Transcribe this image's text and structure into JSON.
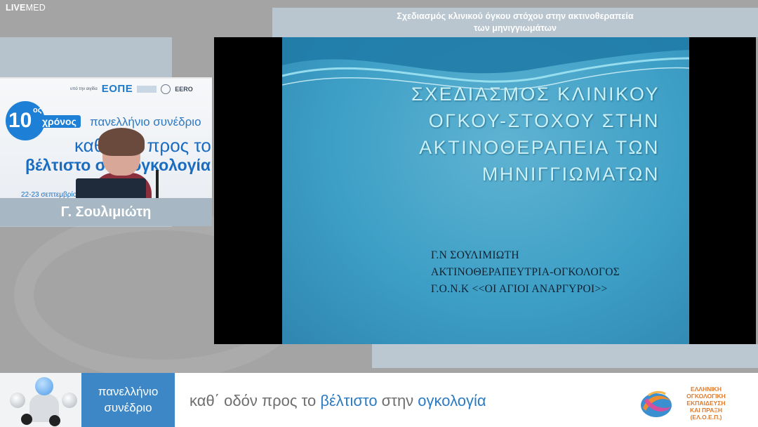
{
  "brand": {
    "bold": "LIVE",
    "light": "MED"
  },
  "talk_title": {
    "line1": "Σχεδιασμός κλινικού όγκου στόχου στην ακτινοθεραπεία",
    "line2": "των μηνιγγιωμάτων"
  },
  "speaker": {
    "name": "Γ. Σουλιμιώτη",
    "video": {
      "under_the_auspices": "υπό την αιγίδα",
      "org_acronym": "ΕΟΠΕ",
      "eero": "EERO",
      "years_number": "10",
      "years_suffix": "ος",
      "years_word": "χρόνος",
      "congress": "πανελλήνιο συνέδριο",
      "slogan_part": "καθ' ... ν προς το",
      "slogan_part2": "βέλτιστο στ... ογκολογία",
      "date_fragment": "22-23 σεπτεμβρίου"
    }
  },
  "slide": {
    "title_lines": [
      "ΣΧΕΔΙΑΣΜΟΣ ΚΛΙΝΙΚΟΥ",
      "ΟΓΚΟΥ-ΣΤΟΧΟΥ ΣΤΗΝ",
      "ΑΚΤΙΝΟΘΕΡΑΠΕΙΑ ΤΩΝ",
      "ΜΗΝΙΓΓΙΩΜΑΤΩΝ"
    ],
    "author_lines": [
      "Γ.Ν ΣΟΥΛΙΜΙΩΤΗ",
      "ΑΚΤΙΝΟΘΕΡΑΠΕΥΤΡΙΑ-ΟΓΚΟΛΟΓΟΣ",
      "Γ.Ο.Ν.Κ <<ΟΙ ΑΓΙΟΙ ΑΝΑΡΓΥΡΟΙ>>"
    ]
  },
  "banner": {
    "panel_line1": "πανελλήνιο",
    "panel_line2": "συνέδριο",
    "slogan_a": "καθ΄ οδόν προς το ",
    "slogan_b": "βέλτιστο",
    "slogan_c": " στην ",
    "slogan_d": "ογκολογία",
    "org_text_lines": [
      "ΕΛΛΗΝΙΚΗ",
      "ΟΓΚΟΛΟΓΙΚΗ",
      "ΕΚΠΑΙΔΕΥΣΗ",
      "ΚΑΙ ΠΡΑΞΗ",
      "(ΕΛ.Ο.Ε.Π.)"
    ]
  },
  "colors": {
    "background": "#a4a4a4",
    "slide_blue": "#3e9fc6",
    "title_cyan": "#c9f1f7",
    "banner_blue": "#3d87c6",
    "org_orange": "#e07a2a"
  }
}
